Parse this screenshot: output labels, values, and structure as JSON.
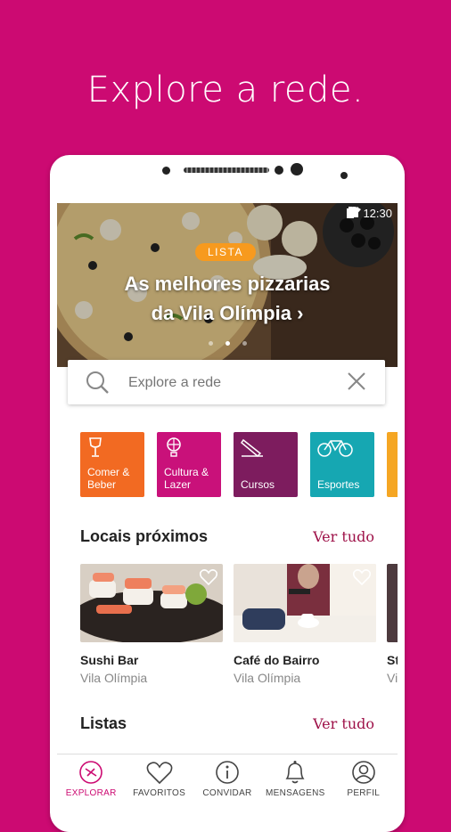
{
  "headline": "Explore a rede.",
  "status": {
    "time": "12:30"
  },
  "hero": {
    "badge": "LISTA",
    "title_line1": "As melhores pizzarias",
    "title_line2": "da Vila Olímpia",
    "arrow": "›"
  },
  "search": {
    "placeholder": "Explore a rede"
  },
  "categories": [
    {
      "label": "Comer &\nBeber",
      "icon": "wine-glass-icon",
      "color": "#f26a22"
    },
    {
      "label": "Cultura &\nLazer",
      "icon": "balloon-icon",
      "color": "#c9117a"
    },
    {
      "label": "Cursos",
      "icon": "pencil-icon",
      "color": "#7d1c5e"
    },
    {
      "label": "Esportes",
      "icon": "bicycle-icon",
      "color": "#16a7b2"
    }
  ],
  "nearby": {
    "title": "Locais próximos",
    "see_all": "Ver tudo",
    "items": [
      {
        "name": "Sushi Bar",
        "area": "Vila Olímpia"
      },
      {
        "name": "Café do Bairro",
        "area": "Vila Olímpia"
      },
      {
        "name": "St",
        "area": "Vi"
      }
    ]
  },
  "lists": {
    "title": "Listas",
    "see_all": "Ver tudo"
  },
  "tabs": [
    {
      "label": "EXPLORAR",
      "icon": "explore-icon",
      "active": true
    },
    {
      "label": "FAVORITOS",
      "icon": "heart-icon",
      "active": false
    },
    {
      "label": "CONVIDAR",
      "icon": "info-icon",
      "active": false
    },
    {
      "label": "MENSAGENS",
      "icon": "bell-icon",
      "active": false
    },
    {
      "label": "PERFIL",
      "icon": "user-icon",
      "active": false
    }
  ],
  "colors": {
    "brand": "#cc0a72",
    "accent_link": "#9e1148",
    "badge": "#f79a1e"
  }
}
